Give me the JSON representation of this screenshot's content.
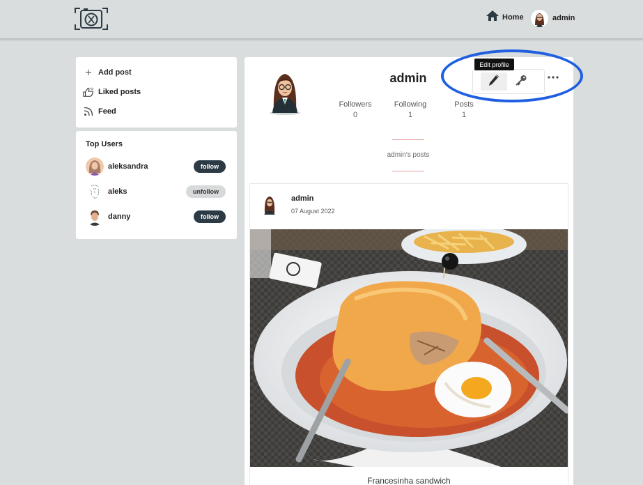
{
  "nav": {
    "home_label": "Home",
    "user_label": "admin"
  },
  "sidebar": {
    "items": [
      {
        "label": "Add post",
        "icon": "plus-icon"
      },
      {
        "label": "Liked posts",
        "icon": "thumbs-up-icon"
      },
      {
        "label": "Feed",
        "icon": "rss-icon"
      }
    ]
  },
  "top_users": {
    "title": "Top Users",
    "users": [
      {
        "name": "aleksandra",
        "action": "follow"
      },
      {
        "name": "aleks",
        "action": "unfollow"
      },
      {
        "name": "danny",
        "action": "follow"
      }
    ]
  },
  "profile": {
    "username": "admin",
    "stats": [
      {
        "label": "Followers",
        "value": "0"
      },
      {
        "label": "Following",
        "value": "1"
      },
      {
        "label": "Posts",
        "value": "1"
      }
    ],
    "edit_tooltip": "Edit profile",
    "more_icon": "more-horizontal-icon",
    "posts_tab": "admin's posts"
  },
  "post": {
    "author": "admin",
    "date": "07 August 2022",
    "caption": "Francesinha sandwich"
  },
  "colors": {
    "accent_dark": "#2b3a44",
    "highlight": "#1f5fe0",
    "divider": "#e59a9a"
  }
}
